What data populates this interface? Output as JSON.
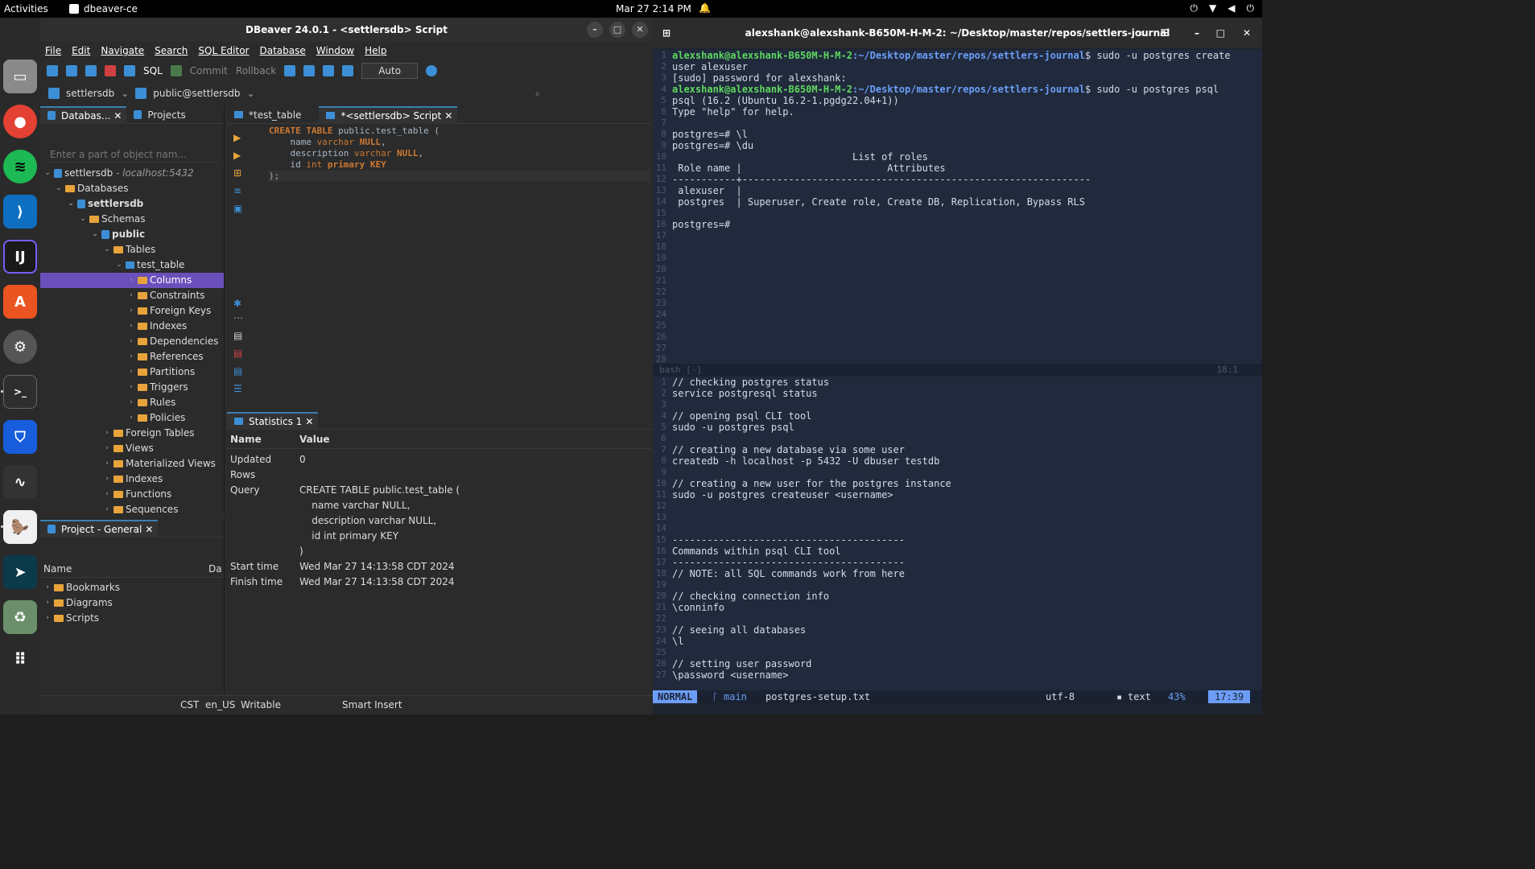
{
  "topbar": {
    "activities": "Activities",
    "app": "dbeaver-ce",
    "clock": "Mar 27  2:14 PM"
  },
  "dbeaver": {
    "title": "DBeaver 24.0.1 - <settlersdb> Script",
    "menu": [
      "File",
      "Edit",
      "Navigate",
      "Search",
      "SQL Editor",
      "Database",
      "Window",
      "Help"
    ],
    "toolbar": {
      "sql": "SQL",
      "commit": "Commit",
      "rollback": "Rollback",
      "auto": "Auto"
    },
    "toolbar2": {
      "datasource": "settlersdb",
      "schema": "public@settlersdb"
    },
    "nav_tabs": [
      "Databas...",
      "Projects"
    ],
    "filter_placeholder": "Enter a part of object nam...",
    "tree": {
      "conn": "settlersdb",
      "conn_host": "- localhost:5432",
      "databases": "Databases",
      "db": "settlersdb",
      "schemas": "Schemas",
      "schema": "public",
      "tables": "Tables",
      "table": "test_table",
      "columns": "Columns",
      "constraints": "Constraints",
      "foreign_keys": "Foreign Keys",
      "indexes": "Indexes",
      "dependencies": "Dependencies",
      "references": "References",
      "partitions": "Partitions",
      "triggers": "Triggers",
      "rules": "Rules",
      "policies": "Policies",
      "foreign_tables": "Foreign Tables",
      "views": "Views",
      "materialized_views": "Materialized Views",
      "indexes2": "Indexes",
      "functions": "Functions",
      "sequences": "Sequences"
    },
    "project": {
      "tab": "Project - General",
      "col_name": "Name",
      "col_da": "Da",
      "items": [
        "Bookmarks",
        "Diagrams",
        "Scripts"
      ]
    },
    "editor_tabs": [
      "*test_table",
      "*<settlersdb> Script"
    ],
    "code": {
      "l1a": "CREATE TABLE",
      "l1b": " public.test_table (",
      "l2a": "    name ",
      "l2b": "varchar",
      "l2c": " NULL",
      "l2d": ",",
      "l3a": "    description ",
      "l3b": "varchar",
      "l3c": " NULL",
      "l3d": ",",
      "l4a": "    id ",
      "l4b": "int",
      "l4c": " primary KEY",
      "l5": ");"
    },
    "stats": {
      "tab": "Statistics 1",
      "h_name": "Name",
      "h_value": "Value",
      "updated_rows_k": "Updated Rows",
      "updated_rows_v": "0",
      "query_k": "Query",
      "query_v1": "CREATE TABLE public.test_table (",
      "query_v2": "    name varchar NULL,",
      "query_v3": "    description varchar NULL,",
      "query_v4": "    id int primary KEY",
      "query_v5": ")",
      "start_k": "Start time",
      "start_v": "Wed Mar 27 14:13:58 CDT 2024",
      "finish_k": "Finish time",
      "finish_v": "Wed Mar 27 14:13:58 CDT 2024"
    },
    "status": {
      "tz": "CST",
      "locale": "en_US",
      "mode": "Writable",
      "insert": "Smart Insert"
    }
  },
  "terminal": {
    "title": "alexshank@alexshank-B650M-H-M-2: ~/Desktop/master/repos/settlers-journal",
    "prompt_user": "alexshank@alexshank-B650M-H-M-2",
    "prompt_path": ":~/Desktop/master/repos/settlers-journal",
    "cmd1": "$ sudo -u postgres create",
    "cmd1b": "user alexuser",
    "sudo": "[sudo] password for alexshank:",
    "cmd2": "$ sudo -u postgres psql",
    "psql_ver": "psql (16.2 (Ubuntu 16.2-1.pgdg22.04+1))",
    "help": "Type \"help\" for help.",
    "p_l": "postgres=# \\l",
    "p_du": "postgres=# \\du",
    "roles_title": "                               List of roles",
    "roles_hdr": " Role name |                         Attributes",
    "roles_sep": "-----------+------------------------------------------------------------",
    "role1": " alexuser  |",
    "role2": " postgres  | Superuser, Create role, Create DB, Replication, Bypass RLS",
    "p_end": "postgres=#",
    "sep_label": "bash [-]",
    "sep_pos": "18:1",
    "file_lines": [
      "// checking postgres status",
      "service postgresql status",
      "",
      "// opening psql CLI tool",
      "sudo -u postgres psql",
      "",
      "// creating a new database via some user",
      "createdb -h localhost -p 5432 -U dbuser testdb",
      "",
      "// creating a new user for the postgres instance",
      "sudo -u postgres createuser <username>",
      "",
      "",
      "",
      "----------------------------------------",
      "Commands within psql CLI tool",
      "----------------------------------------",
      "// NOTE: all SQL commands work from here",
      "",
      "// checking connection info",
      "\\conninfo",
      "",
      "// seeing all databases",
      "\\l",
      "",
      "// setting user password",
      "\\password <username>"
    ],
    "vim": {
      "mode": "NORMAL",
      "branch": "main",
      "file": "postgres-setup.txt",
      "enc": "utf-8",
      "ft": "text",
      "pct": "43%",
      "pos": "17:39"
    }
  }
}
